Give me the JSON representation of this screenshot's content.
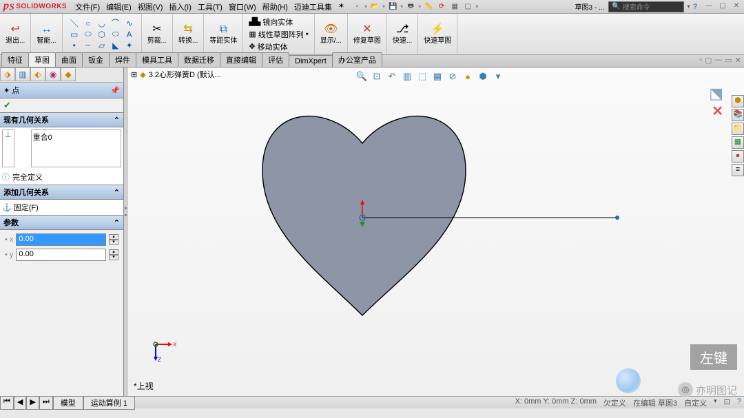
{
  "app": {
    "name": "SOLIDWORKS"
  },
  "menus": [
    "文件(F)",
    "编辑(E)",
    "视图(V)",
    "插入(I)",
    "工具(T)",
    "窗口(W)",
    "帮助(H)",
    "迈迪工具集"
  ],
  "search_placeholder": "搜索命令",
  "doc_dropdown": "草图3 - ...",
  "ribbon": {
    "exit_sketch": "退出...",
    "smart_dim": "智能...",
    "trim": "剪裁...",
    "convert": "转换...",
    "offset": "等距实体",
    "mirror": "镜向实体",
    "pattern": "线性草图阵列",
    "move": "移动实体",
    "display": "显示/...",
    "repair": "修复草图",
    "quick": "快速...",
    "quick2": "快速草图"
  },
  "tabs": [
    "特征",
    "草图",
    "曲面",
    "钣金",
    "焊件",
    "模具工具",
    "数据迁移",
    "直接编辑",
    "评估",
    "DimXpert",
    "办公室产品"
  ],
  "active_tab": "草图",
  "pm": {
    "title": "点",
    "sec1": "现有几何关系",
    "relation": "重合0",
    "status": "完全定义",
    "sec2": "添加几何关系",
    "fix": "固定(F)",
    "sec3": "参数",
    "x_val": "0.00",
    "y_val": "0.00"
  },
  "doc_name": "3.2心形弹簧D  (默认...",
  "view_label": "*上视",
  "bottom_tabs": [
    "模型",
    "运动算例 1"
  ],
  "status": {
    "file": "3.2心形弹簧D",
    "coords": "X: 0mm Y: 0mm Z: 0mm",
    "under": "欠定义",
    "edit": "在编辑 草图3",
    "custom": "自定义"
  },
  "annotation": "左键",
  "watermark": "亦明图记"
}
